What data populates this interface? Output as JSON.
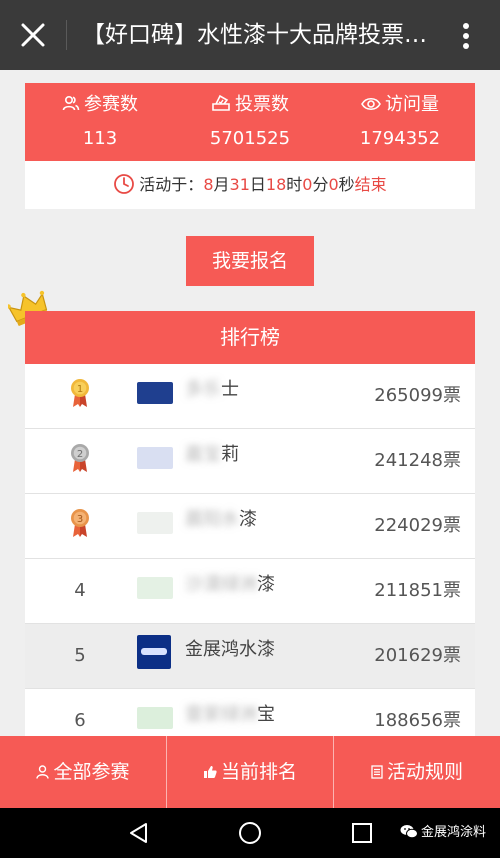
{
  "titlebar": {
    "title": "【好口碑】水性漆十大品牌投票活动",
    "close_icon": "close-icon",
    "more_icon": "more-vertical-icon"
  },
  "stats": {
    "participants": {
      "label": "参赛数",
      "value": "113",
      "icon": "users-icon"
    },
    "votes": {
      "label": "投票数",
      "value": "5701525",
      "icon": "ballot-icon"
    },
    "visits": {
      "label": "访问量",
      "value": "1794352",
      "icon": "eye-icon"
    }
  },
  "timer": {
    "prefix": "活动于：",
    "month": "8",
    "month_unit": "月",
    "day": "31",
    "day_unit": "日",
    "hour": "18",
    "hour_unit": "时",
    "minute": "0",
    "minute_unit": "分",
    "second": "0",
    "second_unit": "秒",
    "suffix": "结束",
    "icon": "clock-icon"
  },
  "signup_button": "我要报名",
  "ranking": {
    "title": "排行榜",
    "crown_icon": "crown-icon",
    "rows": [
      {
        "rank": "1",
        "medal": "gold",
        "name_visible": "士",
        "votes": "265099票"
      },
      {
        "rank": "2",
        "medal": "silver",
        "name_visible": "莉",
        "votes": "241248票"
      },
      {
        "rank": "3",
        "medal": "bronze",
        "name_visible": "漆",
        "votes": "224029票"
      },
      {
        "rank": "4",
        "name_visible": "漆",
        "votes": "211851票"
      },
      {
        "rank": "5",
        "name_visible": "金展鸿水漆",
        "votes": "201629票"
      },
      {
        "rank": "6",
        "name_visible": "宝",
        "votes": "188656票"
      }
    ]
  },
  "bottom_tabs": [
    {
      "label": "全部参赛",
      "icon": "person-icon"
    },
    {
      "label": "当前排名",
      "icon": "thumbs-up-icon"
    },
    {
      "label": "活动规则",
      "icon": "document-icon"
    }
  ],
  "navbar": {
    "watermark": "金展鸿涂料"
  },
  "colors": {
    "accent": "#f65a55",
    "titlebar": "#3a3a3a",
    "timer_highlight": "#e84a45",
    "highlight_row": "#ededed"
  }
}
